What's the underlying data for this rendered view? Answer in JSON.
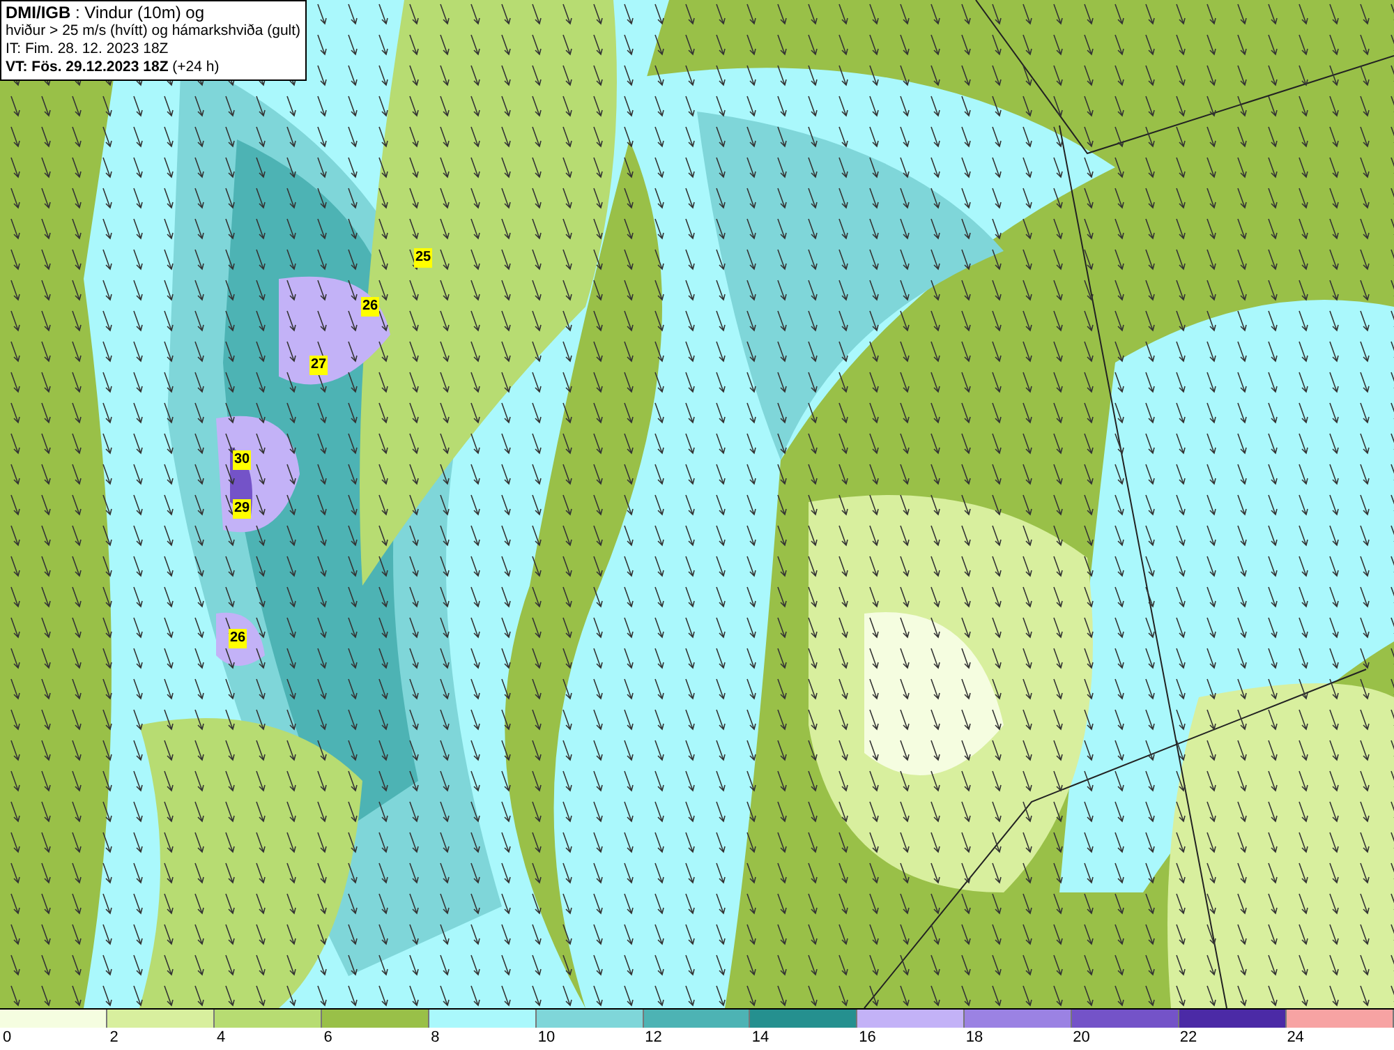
{
  "header": {
    "lines": [
      "**DMI/IGB** : Vindur (10m) og",
      "hviður > 25 m/s (hvítt) og hámarkshviða (gult)",
      "IT: Fim. 28. 12. 2023 18Z",
      "**VT: Fös. 29.12.2023 18Z** (+24 h)"
    ]
  },
  "gust_labels": [
    {
      "text": "25"
    },
    {
      "text": "26"
    },
    {
      "text": "27"
    },
    {
      "text": "30"
    },
    {
      "text": "29"
    },
    {
      "text": "26"
    }
  ],
  "legend": {
    "bands": [
      {
        "color": "#f5fde0"
      },
      {
        "color": "#d8ef9e"
      },
      {
        "color": "#b7dc72"
      },
      {
        "color": "#99c048"
      },
      {
        "color": "#aaf8fc"
      },
      {
        "color": "#7fd6d9"
      },
      {
        "color": "#4db3b4"
      },
      {
        "color": "#25908f"
      },
      {
        "color": "#c3b2f7"
      },
      {
        "color": "#9b82e3"
      },
      {
        "color": "#7453c8"
      },
      {
        "color": "#4b2aa6"
      },
      {
        "color": "#f7a3a3"
      }
    ],
    "ticks": [
      "0",
      "2",
      "4",
      "6",
      "8",
      "10",
      "12",
      "14",
      "16",
      "18",
      "20",
      "22",
      "24"
    ]
  }
}
